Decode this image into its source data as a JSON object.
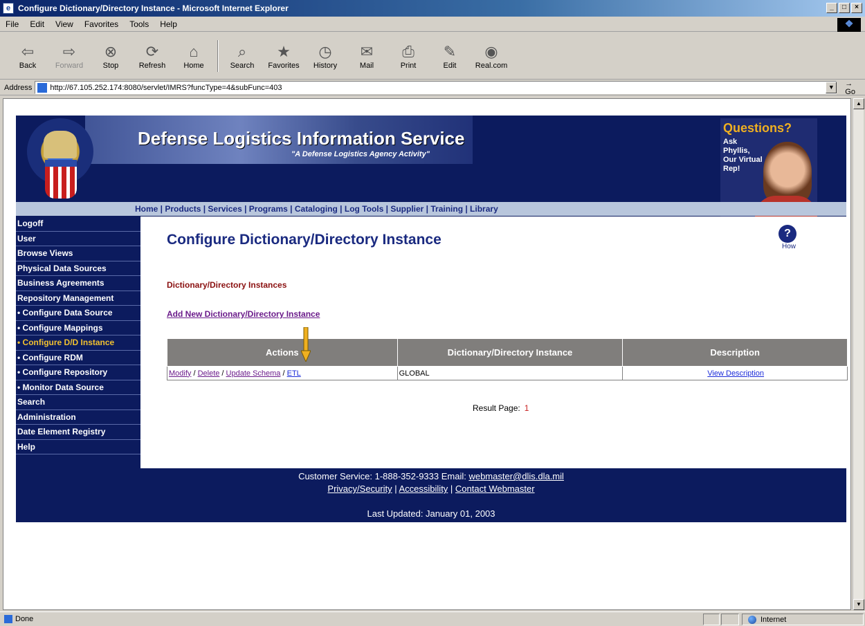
{
  "window": {
    "title": "Configure Dictionary/Directory Instance - Microsoft Internet Explorer",
    "minimize": "_",
    "maximize": "□",
    "close": "×"
  },
  "menu": [
    "File",
    "Edit",
    "View",
    "Favorites",
    "Tools",
    "Help"
  ],
  "toolbar": {
    "back": "Back",
    "forward": "Forward",
    "stop": "Stop",
    "refresh": "Refresh",
    "home": "Home",
    "search": "Search",
    "favorites": "Favorites",
    "history": "History",
    "mail": "Mail",
    "print": "Print",
    "edit": "Edit",
    "realcom": "Real.com"
  },
  "address": {
    "label": "Address",
    "url": "http://67.105.252.174:8080/servlet/IMRS?funcType=4&subFunc=403",
    "go": "Go"
  },
  "banner": {
    "title": "Defense Logistics Information Service",
    "subtitle": "\"A Defense Logistics Agency Activity\"",
    "questions_title": "Questions?",
    "questions_body": "Ask Phyllis, Our Virtual Rep!"
  },
  "topnav": "Home | Products | Services | Programs | Cataloging | Log Tools | Supplier | Training | Library",
  "sidenav": [
    {
      "label": "Logoff"
    },
    {
      "label": "User"
    },
    {
      "label": "Browse Views"
    },
    {
      "label": "Physical Data Sources"
    },
    {
      "label": "Business Agreements"
    },
    {
      "label": "Repository Management"
    },
    {
      "label": "• Configure Data Source"
    },
    {
      "label": "• Configure Mappings"
    },
    {
      "label": "• Configure D/D Instance"
    },
    {
      "label": "• Configure RDM"
    },
    {
      "label": "• Configure Repository"
    },
    {
      "label": "• Monitor Data Source"
    },
    {
      "label": "Search"
    },
    {
      "label": "Administration"
    },
    {
      "label": "Date Element Registry"
    },
    {
      "label": "Help"
    }
  ],
  "content": {
    "page_title": "Configure Dictionary/Directory Instance",
    "help_label": "How",
    "section_label": "Dictionary/Directory Instances",
    "add_link": "Add New Dictionary/Directory Instance",
    "table": {
      "headers": [
        "Actions",
        "Dictionary/Directory Instance",
        "Description"
      ],
      "row": {
        "modify": "Modify",
        "delete": "Delete",
        "update_schema": "Update Schema",
        "etl": "ETL",
        "sep": " / ",
        "instance": "GLOBAL",
        "description": "View Description"
      }
    },
    "result_label": "Result Page:",
    "result_page": "1"
  },
  "footer": {
    "customer_service": "Customer Service: 1-888-352-9333 Email: ",
    "email": "webmaster@dlis.dla.mil",
    "privacy": "Privacy/Security",
    "accessibility": "Accessibility",
    "contact": "Contact Webmaster",
    "updated": "Last Updated: January 01, 2003"
  },
  "status": {
    "text": "Done",
    "zone": "Internet"
  },
  "colors": {
    "navy": "#0c1b5e",
    "nav_active": "#f0c030",
    "arrow": "#f0b020"
  }
}
